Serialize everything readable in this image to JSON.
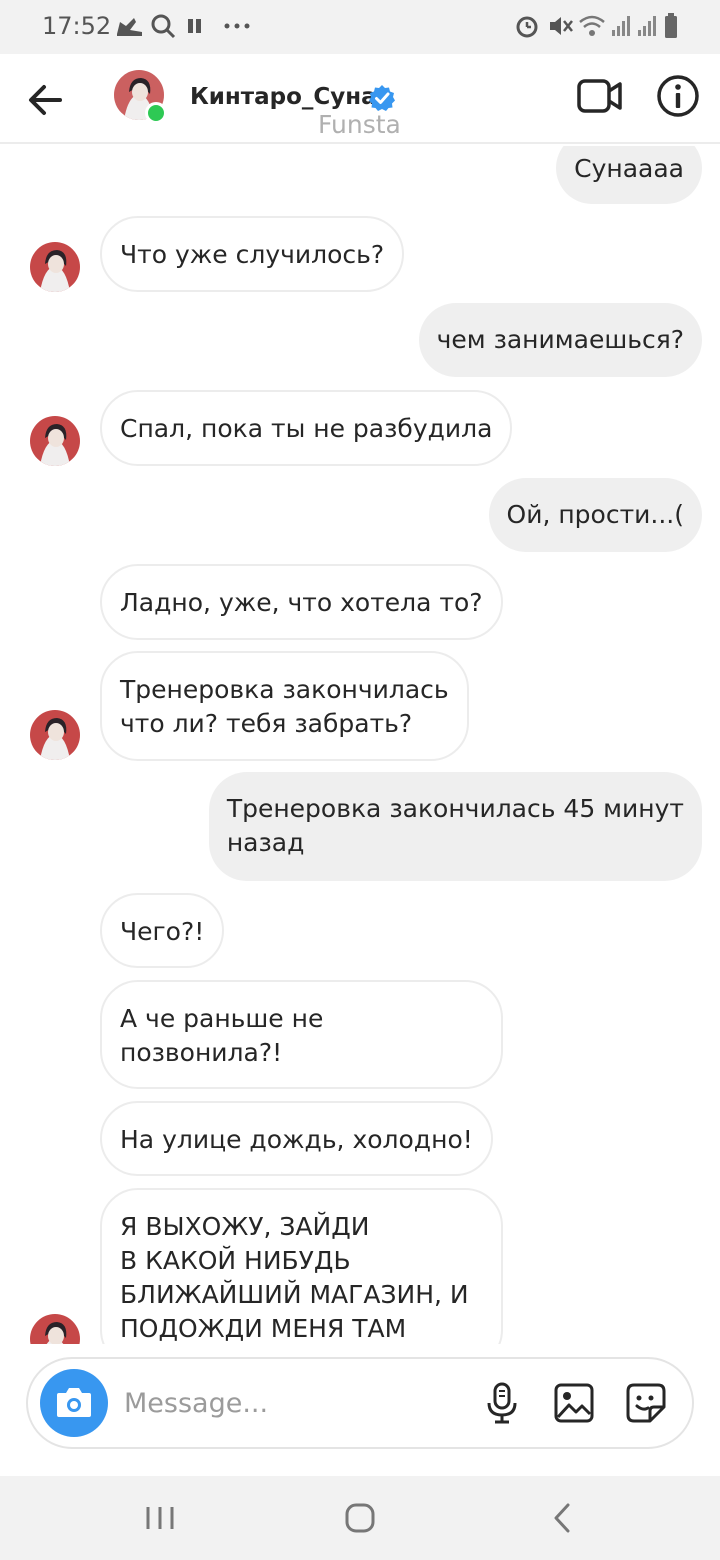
{
  "status_bar": {
    "time": "17:52",
    "icons": [
      "shoe-icon",
      "search-icon",
      "pause-icon",
      "more-dots-icon",
      "alarm-icon",
      "mute-icon",
      "wifi-icon",
      "signal-icon",
      "signal-icon",
      "battery-icon"
    ]
  },
  "header": {
    "name": "Кинтаро_Суна",
    "subtitle": "Funsta",
    "verified": true,
    "online": true,
    "icons": [
      "back-arrow-icon",
      "video-call-icon",
      "info-icon"
    ]
  },
  "messages": [
    {
      "dir": "out",
      "text": "Сунаааа"
    },
    {
      "dir": "in",
      "text": "Что уже случилось?",
      "avatar": true
    },
    {
      "dir": "out",
      "text": "чем занимаешься?"
    },
    {
      "dir": "in",
      "text": "Спал, пока ты не разбудила",
      "avatar": true
    },
    {
      "dir": "out",
      "text": "Ой, прости...("
    },
    {
      "dir": "in",
      "text": "Ладно, уже, что хотела то?",
      "avatar": false
    },
    {
      "dir": "in",
      "text": "Тренеровка закончилась\nчто ли? тебя забрать?",
      "avatar": true
    },
    {
      "dir": "out",
      "text": "Тренеровка закончилась 45 минут\nназад"
    },
    {
      "dir": "in",
      "text": "Чего?!",
      "avatar": false
    },
    {
      "dir": "in",
      "text": "А че раньше не\nпозвонила?!",
      "avatar": false
    },
    {
      "dir": "in",
      "text": "На улице дождь, холодно!",
      "avatar": false
    },
    {
      "dir": "in",
      "text": "Я ВЫХОЖУ, ЗАЙДИ\nВ КАКОЙ НИБУДЬ\nБЛИЖАЙШИЙ МАГАЗИН, И\nПОДОЖДИ МЕНЯ ТАМ",
      "avatar": true
    }
  ],
  "composer": {
    "placeholder": "Message...",
    "icons": [
      "camera-icon",
      "microphone-icon",
      "gallery-icon",
      "sticker-icon"
    ]
  },
  "nav_bar": {
    "icons": [
      "recent-apps-icon",
      "home-icon",
      "back-icon"
    ]
  },
  "colors": {
    "accent": "#3897f0",
    "online": "#2ec954",
    "outgoing_bubble": "#efefef",
    "incoming_border": "#ececec"
  }
}
